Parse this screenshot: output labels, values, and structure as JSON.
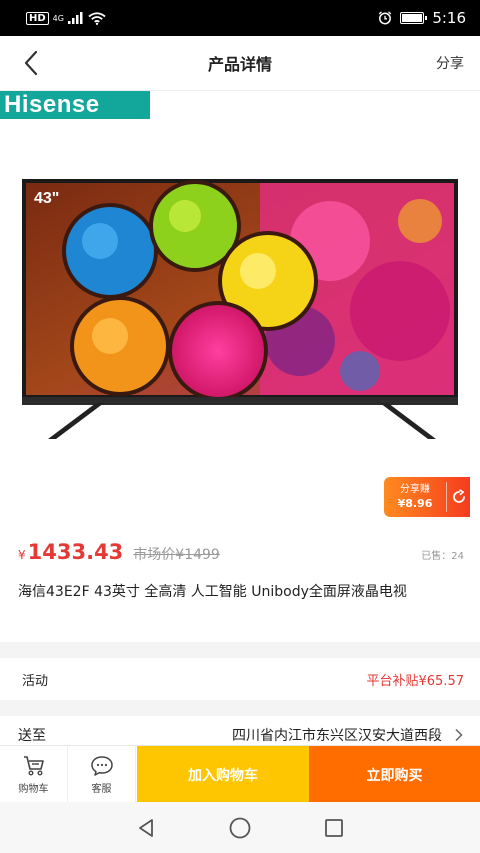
{
  "status_bar": {
    "hd": "HD",
    "network": "4G",
    "time": "5:16",
    "battery_level": 0.9
  },
  "header": {
    "title": "产品详情",
    "share_label": "分享",
    "back_icon": "chevron-left-icon"
  },
  "product": {
    "brand": "Hisense",
    "screen_size_badge": "43\"",
    "share_earn_label": "分享赚",
    "share_earn_amount": "¥8.96",
    "currency_symbol": "¥",
    "price": "1433.43",
    "market_price": "市场价¥1499",
    "sold_text": "已售：24",
    "title": "海信43E2F 43英寸 全高清 人工智能 Unibody全面屏液晶电视"
  },
  "activity": {
    "label": "活动",
    "value": "平台补贴¥65.57"
  },
  "delivery": {
    "label": "送至",
    "address": "四川省内江市东兴区汉安大道西段"
  },
  "action_bar": {
    "cart_label": "购物车",
    "service_label": "客服",
    "add_to_cart": "加入购物车",
    "buy_now": "立即购买"
  },
  "colors": {
    "price_red": "#e53935",
    "add_cart_yellow": "#fdc600",
    "buy_now_orange": "#ff6d00",
    "brand_teal": "#13a69a"
  }
}
